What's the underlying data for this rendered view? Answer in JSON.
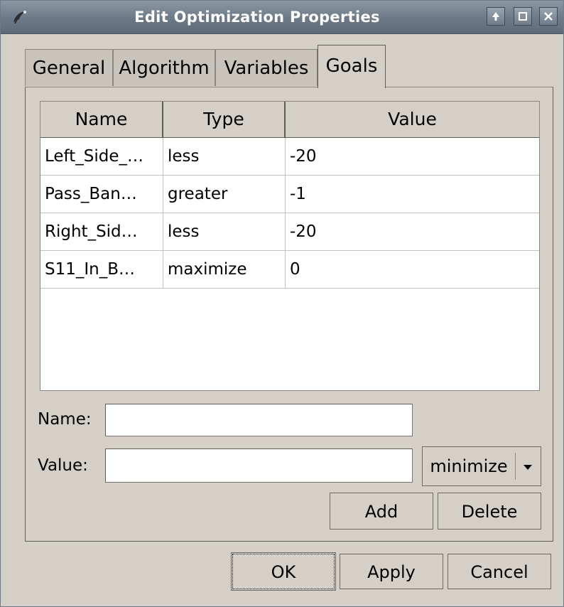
{
  "window": {
    "title": "Edit Optimization Properties"
  },
  "tabs": [
    {
      "label": "General"
    },
    {
      "label": "Algorithm"
    },
    {
      "label": "Variables"
    },
    {
      "label": "Goals",
      "active": true
    }
  ],
  "goals_table": {
    "columns": [
      "Name",
      "Type",
      "Value"
    ],
    "rows": [
      {
        "name": "Left_Side_…",
        "type": "less",
        "value": "-20"
      },
      {
        "name": "Pass_Ban…",
        "type": "greater",
        "value": "-1"
      },
      {
        "name": "Right_Sid…",
        "type": "less",
        "value": "-20"
      },
      {
        "name": "S11_In_B…",
        "type": "maximize",
        "value": "0"
      }
    ]
  },
  "form": {
    "name_label": "Name:",
    "name_value": "",
    "value_label": "Value:",
    "value_value": "",
    "goal_type_selected": "minimize",
    "add_label": "Add",
    "delete_label": "Delete"
  },
  "dialog_buttons": {
    "ok": "OK",
    "apply": "Apply",
    "cancel": "Cancel"
  },
  "icons": {
    "app": "app-icon",
    "up": "up-arrow-icon",
    "maximize": "maximize-icon",
    "close": "close-icon",
    "dropdown": "chevron-down-icon"
  }
}
